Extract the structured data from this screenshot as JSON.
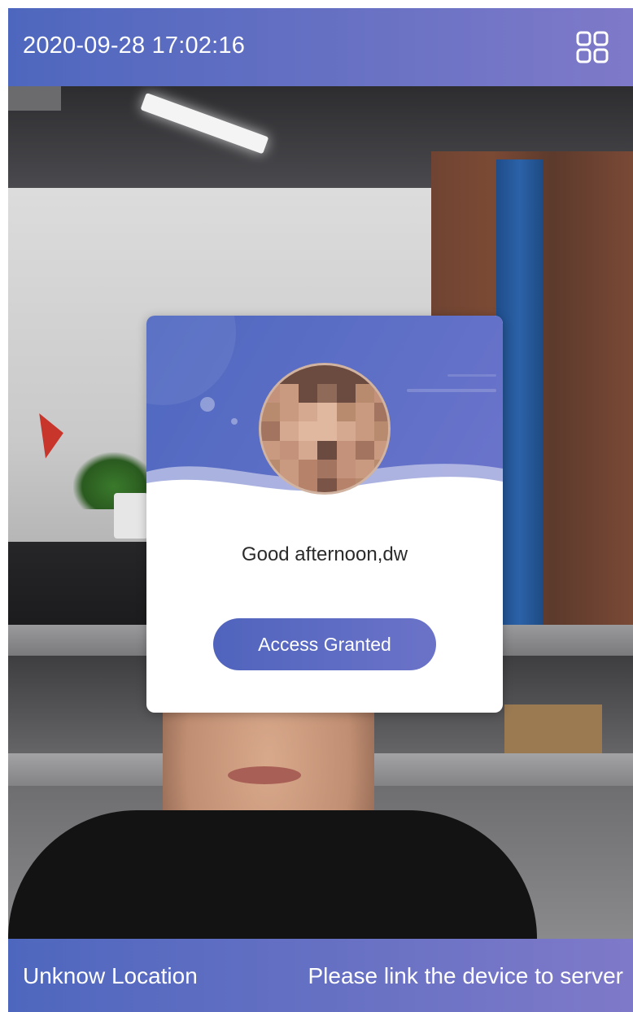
{
  "header": {
    "datetime": "2020-09-28 17:02:16",
    "menu_icon": "grid-apps-icon"
  },
  "card": {
    "greeting": "Good afternoon,dw",
    "status_button_label": "Access Granted",
    "avatar_icon": "user-photo-pixelated"
  },
  "footer": {
    "location": "Unknow Location",
    "server_status": "Please link the device to server"
  },
  "colors": {
    "bar_start": "#4e67be",
    "bar_end": "#7f79c9",
    "button_start": "#5064bd",
    "button_end": "#6b73c8"
  }
}
